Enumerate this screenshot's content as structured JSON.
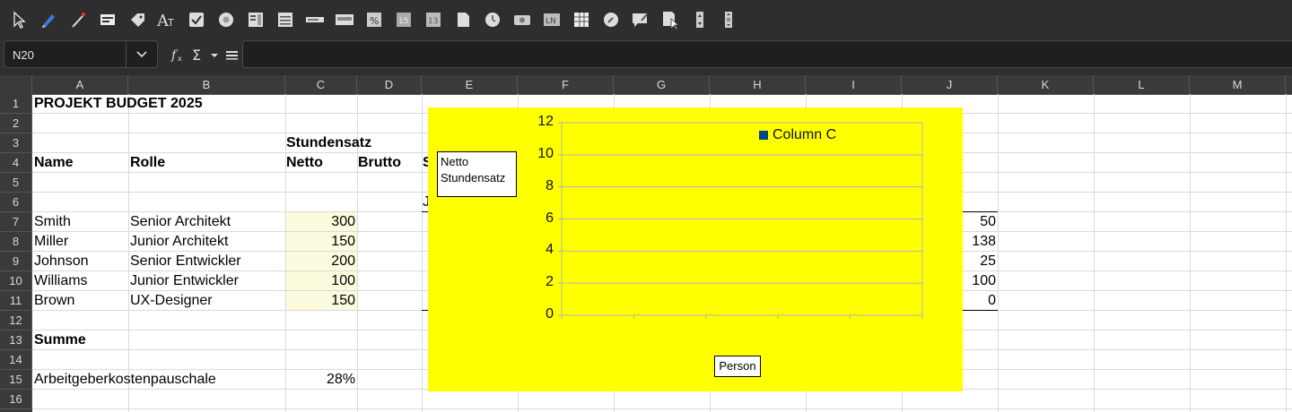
{
  "toolbar": {
    "icons": [
      "select-pointer",
      "pen-tool",
      "magic-wand",
      "card-icon",
      "tag-icon",
      "font-style",
      "checkbox",
      "circle-shape",
      "list-box",
      "text-block",
      "combo",
      "form-field",
      "percent-field",
      "numeric-15",
      "numeric-13",
      "document",
      "clock",
      "camera",
      "label-ln",
      "table-grid",
      "search-circle",
      "chat-edit",
      "document-pointer",
      "spin-button",
      "vertical-scroll"
    ]
  },
  "formula_bar": {
    "name_box": "N20",
    "formula": ""
  },
  "columns": [
    "A",
    "B",
    "C",
    "D",
    "E",
    "F",
    "G",
    "H",
    "I",
    "J",
    "K",
    "L",
    "M"
  ],
  "rows": [
    "1",
    "2",
    "3",
    "4",
    "5",
    "6",
    "7",
    "8",
    "9",
    "10",
    "11",
    "12",
    "13",
    "14",
    "15",
    "16"
  ],
  "cells": {
    "title": "PROJEKT BUDGET 2025",
    "c3": "Stundensatz",
    "a4": "Name",
    "b4": "Rolle",
    "c4": "Netto",
    "d4": "Brutto",
    "e4_partial": "S",
    "e6_partial": "J",
    "names": [
      "Smith",
      "Miller",
      "Johnson",
      "Williams",
      "Brown"
    ],
    "roles": [
      "Senior Architekt",
      "Junior Architekt",
      "Senior Entwickler",
      "Junior Entwickler",
      "UX-Designer"
    ],
    "netto": [
      "300",
      "150",
      "200",
      "100",
      "150"
    ],
    "col_j": [
      "50",
      "138",
      "25",
      "100",
      "0"
    ],
    "a13": "Summe",
    "a15": "Arbeitgeberkostenpauschale",
    "c15": "28%"
  },
  "chart_data": {
    "type": "bar",
    "categories": [
      "",
      "",
      "",
      "",
      ""
    ],
    "series": [
      {
        "name": "Column C",
        "values": [
          0,
          0,
          0,
          0,
          0
        ]
      }
    ],
    "title": "",
    "xlabel": "Person",
    "ylabel": "Netto Stundensatz",
    "ylabel_lines": [
      "Netto",
      "Stundensatz"
    ],
    "ylim": [
      0,
      12
    ],
    "yticks": [
      "12",
      "10",
      "8",
      "6",
      "4",
      "2",
      "0"
    ],
    "grid": true,
    "legend": "top-right",
    "background": "#ffff00",
    "series_color": "#004586"
  }
}
